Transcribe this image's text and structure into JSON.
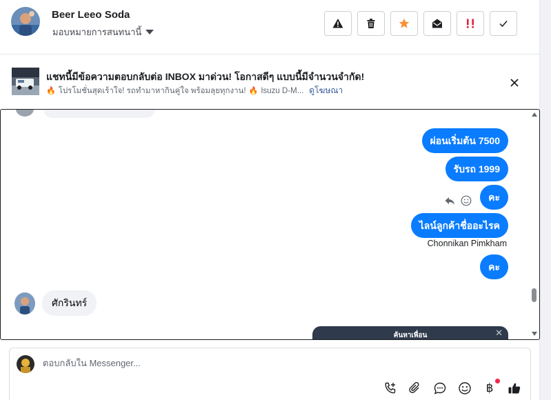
{
  "header": {
    "contact_name": "Beer Leeo Soda",
    "assign_label": "มอบหมายการสนทนานี้",
    "actions": [
      "warning-icon",
      "trash-icon",
      "star-icon",
      "envelope-open-icon",
      "priority-icon",
      "check-icon"
    ],
    "star_color": "#f7923a",
    "priority_color": "#e41e3f"
  },
  "ad": {
    "title": "แชทนี้มีข้อความตอบกลับต่อ INBOX มาด่วน! โอกาสดีๆ แบบนี้มีจำนวนจำกัด!",
    "subtitle_part1": "โปรโมชั่นสุดเร้าใจ! รถทำมาหากินคู่ใจ พร้อมลุยทุกงาน!",
    "subtitle_part2": "Isuzu D-M...",
    "link_label": "ดูโฆษณา"
  },
  "chat": {
    "outgoing": [
      "ผ่อนเริ่มต้น 7500",
      "รับรถ 1999",
      "คะ",
      "ไลน์ลูกค้าชื่ออะไรค",
      "คะ"
    ],
    "sender_name": "Chonnikan Pimkham",
    "incoming": "ศักรินทร์",
    "find_friends_label": "ค้นหาเพื่อน",
    "bubble_color": "#0a7cff"
  },
  "composer": {
    "placeholder": "ตอบกลับใน Messenger...",
    "tools": [
      "call-add-icon",
      "paperclip-icon",
      "chat-bubble-icon",
      "emoji-icon",
      "baht-icon",
      "thumbs-up-icon"
    ],
    "baht_symbol": "฿"
  }
}
